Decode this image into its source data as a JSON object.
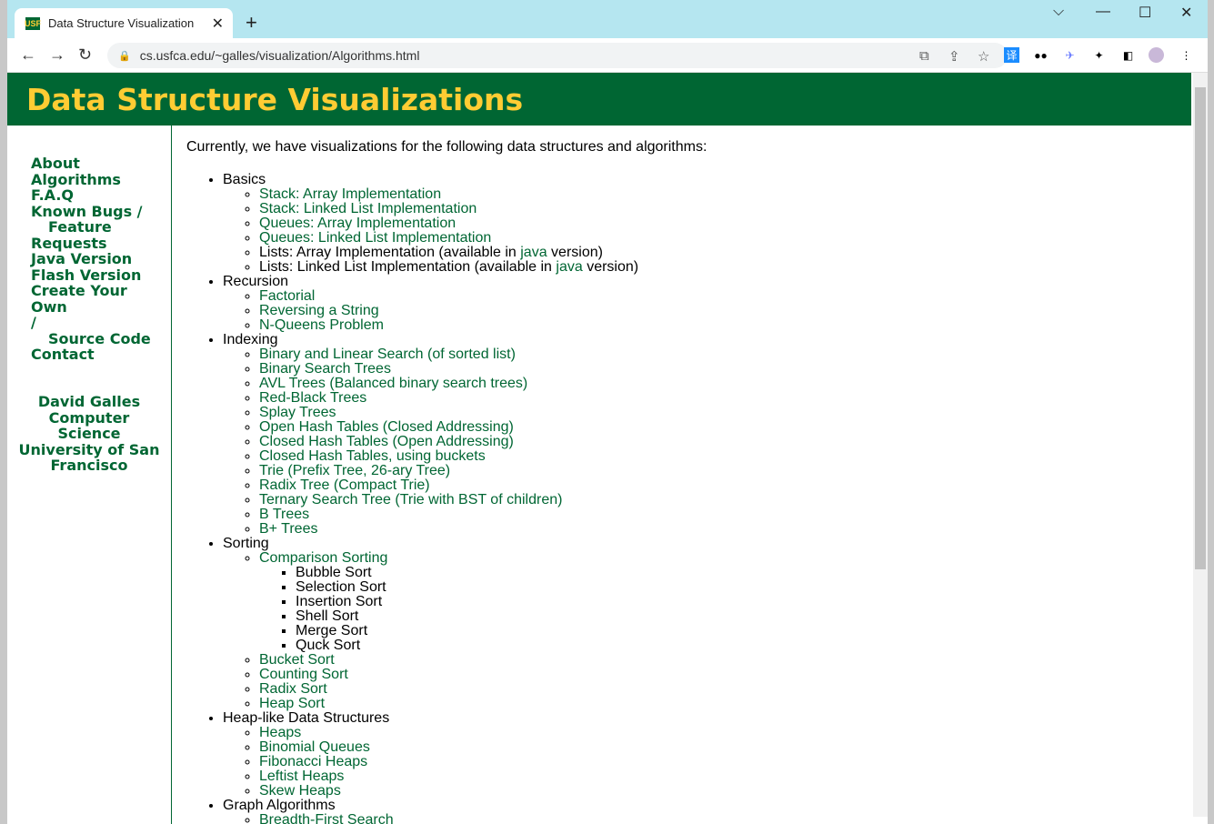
{
  "browser": {
    "tab_title": "Data Structure Visualization",
    "favicon_text": "USF",
    "url": "cs.usfca.edu/~galles/visualization/Algorithms.html",
    "translate_ext": "译"
  },
  "header": {
    "title": "Data Structure Visualizations"
  },
  "sidebar": {
    "nav": [
      {
        "label": "About"
      },
      {
        "label": "Algorithms"
      },
      {
        "label": "F.A.Q"
      },
      {
        "label": "Known Bugs /"
      },
      {
        "label": "Feature",
        "indent": true
      },
      {
        "label": "Requests"
      },
      {
        "label": "Java Version"
      },
      {
        "label": "Flash Version"
      },
      {
        "label": "Create Your Own"
      },
      {
        "label": "/"
      },
      {
        "label": "Source Code",
        "indent": true
      },
      {
        "label": "Contact"
      }
    ],
    "credit": [
      "David Galles",
      "Computer Science",
      "University of San",
      "Francisco"
    ]
  },
  "main": {
    "intro": "Currently, we have visualizations for the following data structures and algorithms:",
    "sections": [
      {
        "title": "Basics",
        "items": [
          {
            "parts": [
              {
                "t": "Stack: Array Implementation",
                "link": true
              }
            ]
          },
          {
            "parts": [
              {
                "t": "Stack: Linked List Implementation",
                "link": true
              }
            ]
          },
          {
            "parts": [
              {
                "t": "Queues: Array Implementation",
                "link": true
              }
            ]
          },
          {
            "parts": [
              {
                "t": "Queues: Linked List Implementation",
                "link": true
              }
            ]
          },
          {
            "parts": [
              {
                "t": "Lists: Array Implementation (available in ",
                "link": false
              },
              {
                "t": "java",
                "link": true
              },
              {
                "t": " version)",
                "link": false
              }
            ]
          },
          {
            "parts": [
              {
                "t": "Lists: Linked List Implementation (available in ",
                "link": false
              },
              {
                "t": "java",
                "link": true
              },
              {
                "t": " version)",
                "link": false
              }
            ]
          }
        ]
      },
      {
        "title": "Recursion",
        "items": [
          {
            "parts": [
              {
                "t": "Factorial",
                "link": true
              }
            ]
          },
          {
            "parts": [
              {
                "t": "Reversing a String",
                "link": true
              }
            ]
          },
          {
            "parts": [
              {
                "t": "N-Queens Problem",
                "link": true
              }
            ]
          }
        ]
      },
      {
        "title": "Indexing",
        "items": [
          {
            "parts": [
              {
                "t": "Binary and Linear Search (of sorted list)",
                "link": true
              }
            ]
          },
          {
            "parts": [
              {
                "t": "Binary Search Trees",
                "link": true
              }
            ]
          },
          {
            "parts": [
              {
                "t": "AVL Trees (Balanced binary search trees)",
                "link": true
              }
            ]
          },
          {
            "parts": [
              {
                "t": "Red-Black Trees",
                "link": true
              }
            ]
          },
          {
            "parts": [
              {
                "t": "Splay Trees",
                "link": true
              }
            ]
          },
          {
            "parts": [
              {
                "t": "Open Hash Tables (Closed Addressing)",
                "link": true
              }
            ]
          },
          {
            "parts": [
              {
                "t": "Closed Hash Tables (Open Addressing)",
                "link": true
              }
            ]
          },
          {
            "parts": [
              {
                "t": "Closed Hash Tables, using buckets",
                "link": true
              }
            ]
          },
          {
            "parts": [
              {
                "t": "Trie (Prefix Tree, 26-ary Tree)",
                "link": true
              }
            ]
          },
          {
            "parts": [
              {
                "t": "Radix Tree (Compact Trie)",
                "link": true
              }
            ]
          },
          {
            "parts": [
              {
                "t": "Ternary Search Tree (Trie with BST of children)",
                "link": true
              }
            ]
          },
          {
            "parts": [
              {
                "t": "B Trees",
                "link": true
              }
            ]
          },
          {
            "parts": [
              {
                "t": "B+ Trees",
                "link": true
              }
            ]
          }
        ]
      },
      {
        "title": "Sorting",
        "items": [
          {
            "parts": [
              {
                "t": "Comparison Sorting",
                "link": true
              }
            ],
            "sub": [
              "Bubble Sort",
              "Selection Sort",
              "Insertion Sort",
              "Shell Sort",
              "Merge Sort",
              "Quck Sort"
            ]
          },
          {
            "parts": [
              {
                "t": "Bucket Sort",
                "link": true
              }
            ]
          },
          {
            "parts": [
              {
                "t": "Counting Sort",
                "link": true
              }
            ]
          },
          {
            "parts": [
              {
                "t": "Radix Sort",
                "link": true
              }
            ]
          },
          {
            "parts": [
              {
                "t": "Heap Sort",
                "link": true
              }
            ]
          }
        ]
      },
      {
        "title": "Heap-like Data Structures",
        "items": [
          {
            "parts": [
              {
                "t": "Heaps",
                "link": true
              }
            ]
          },
          {
            "parts": [
              {
                "t": "Binomial Queues",
                "link": true
              }
            ]
          },
          {
            "parts": [
              {
                "t": "Fibonacci Heaps",
                "link": true
              }
            ]
          },
          {
            "parts": [
              {
                "t": "Leftist Heaps",
                "link": true
              }
            ]
          },
          {
            "parts": [
              {
                "t": "Skew Heaps",
                "link": true
              }
            ]
          }
        ]
      },
      {
        "title": "Graph Algorithms",
        "items": [
          {
            "parts": [
              {
                "t": "Breadth-First Search",
                "link": true
              }
            ]
          }
        ]
      }
    ]
  },
  "colors": {
    "brand_green": "#006633",
    "brand_gold": "#ffcc33",
    "tab_strip": "#b5e6f0"
  }
}
